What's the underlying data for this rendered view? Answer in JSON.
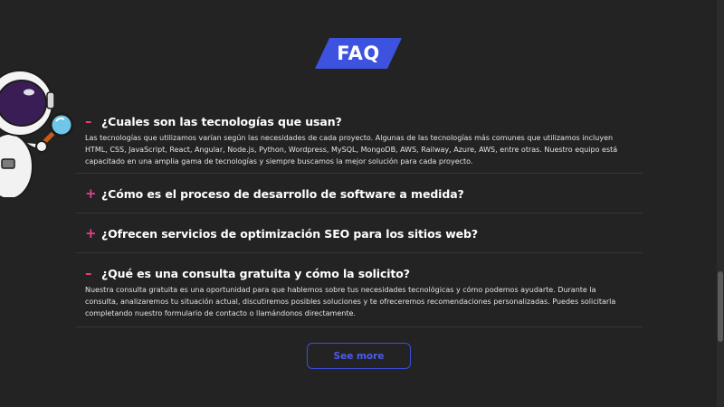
{
  "header": {
    "title": "FAQ"
  },
  "colors": {
    "background": "#232323",
    "accent_blue": "#3e52e0",
    "toggle_pink": "#e0418a",
    "divider": "#363636"
  },
  "faq": {
    "items": [
      {
        "toggle": "–",
        "question": "¿Cuales son las tecnologías que usan?",
        "answer": "Las tecnologías que utilizamos varían según las necesidades de cada proyecto. Algunas de las tecnologías más comunes que utilizamos incluyen HTML, CSS, JavaScript, React, Angular, Node.js, Python, Wordpress, MySQL, MongoDB, AWS, Railway, Azure, AWS, entre otras. Nuestro equipo está capacitado en una amplia gama de tecnologías y siempre buscamos la mejor solución para cada proyecto.",
        "expanded": true
      },
      {
        "toggle": "+",
        "question": "¿Cómo es el proceso de desarrollo de software a medida?",
        "expanded": false
      },
      {
        "toggle": "+",
        "question": "¿Ofrecen servicios de optimización SEO para los sitios web?",
        "expanded": false
      },
      {
        "toggle": "–",
        "question": "¿Qué es una consulta gratuita y cómo la solicito?",
        "answer": "Nuestra consulta gratuita es una oportunidad para que hablemos sobre tus necesidades tecnológicas y cómo podemos ayudarte. Durante la consulta, analizaremos tu situación actual, discutiremos posibles soluciones y te ofreceremos recomendaciones personalizadas. Puedes solicitarla completando nuestro formulario de contacto o llamándonos directamente.",
        "expanded": true
      }
    ]
  },
  "actions": {
    "see_more_label": "See more"
  },
  "icons": {
    "mascot": "astronaut-with-magnifier-icon"
  }
}
